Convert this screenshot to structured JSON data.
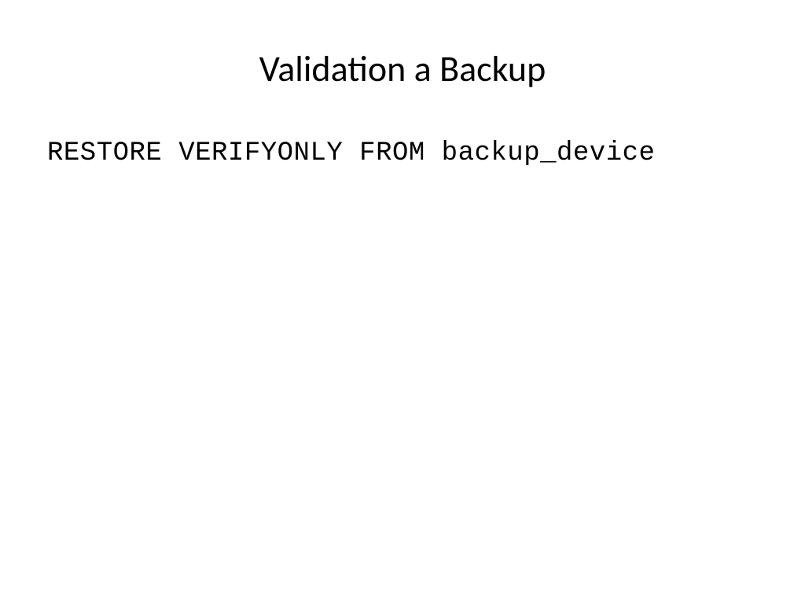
{
  "slide": {
    "title": "Validation a Backup",
    "code": "RESTORE VERIFYONLY FROM backup_device"
  }
}
